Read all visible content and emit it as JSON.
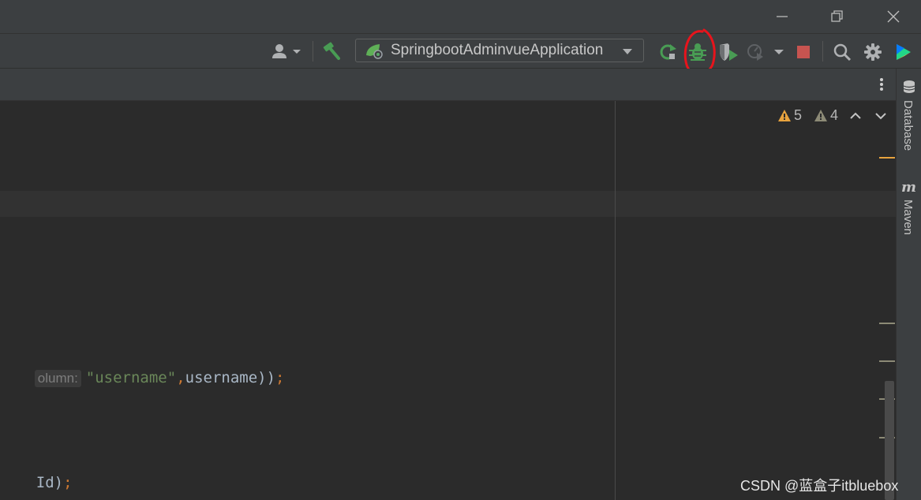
{
  "run_config": {
    "label": "SpringbootAdminvueApplication"
  },
  "inspections": {
    "warnings": "5",
    "weak_warnings": "4"
  },
  "code": {
    "line1": {
      "hint": "olumn:",
      "string": "\"username\"",
      "comma": ",",
      "arg": "username",
      "close": "))",
      "semi": ";"
    },
    "line2": {
      "ident": "Id",
      "close": ")",
      "semi": ";"
    }
  },
  "right_tools": {
    "database": "Database",
    "maven": "Maven"
  },
  "watermark": "CSDN @蓝盒子itbluebox",
  "colors": {
    "accent_green": "#499c54",
    "stop_red": "#c75450",
    "warning_yellow": "#e8a33e",
    "annotation_red": "#e8141c"
  }
}
